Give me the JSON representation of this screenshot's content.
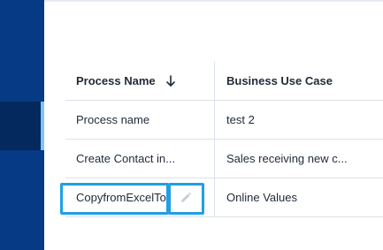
{
  "table": {
    "columns": [
      {
        "label": "Process Name",
        "sort": "descending"
      },
      {
        "label": "Business Use Case"
      }
    ],
    "rows": [
      {
        "process_name": "Process name",
        "business_use_case": "test 2"
      },
      {
        "process_name": "Create Contact in...",
        "business_use_case": "Sales receiving new c..."
      },
      {
        "process_name": "CopyfromExcelTo",
        "business_use_case": "Online Values"
      }
    ]
  },
  "icons": {
    "sort": "arrow-down-icon",
    "edit": "pencil-icon"
  },
  "colors": {
    "sidebar": "#063a84",
    "sidebar_active": "#04295e",
    "sidebar_active_indicator": "#7cc3ff",
    "highlight": "#1f9fe6",
    "border": "#dbe2ea",
    "text": "#1f2a37"
  }
}
